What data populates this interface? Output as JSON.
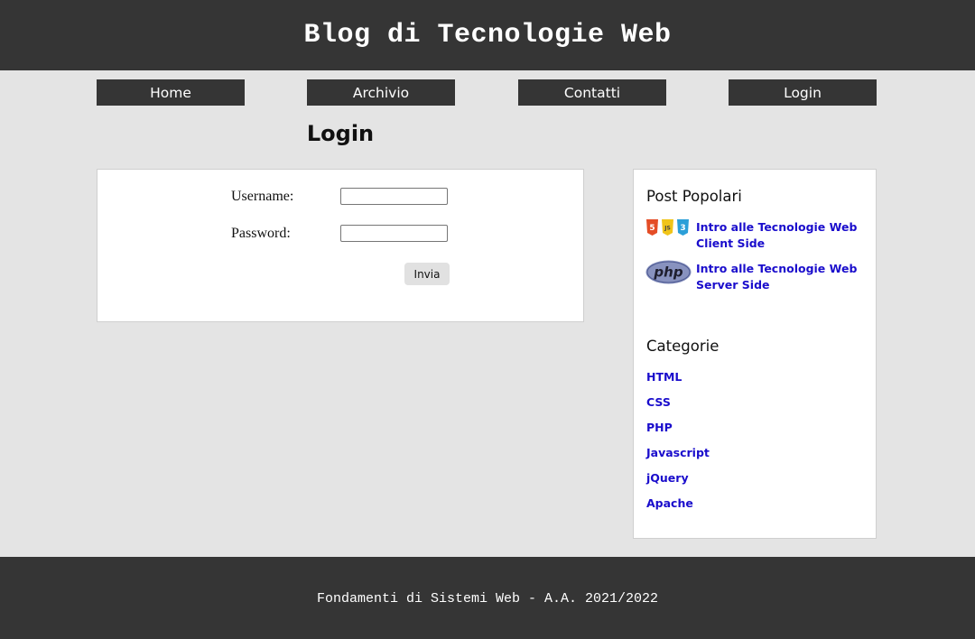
{
  "header": {
    "title": "Blog di Tecnologie Web"
  },
  "nav": {
    "items": [
      {
        "label": "Home"
      },
      {
        "label": "Archivio"
      },
      {
        "label": "Contatti"
      },
      {
        "label": "Login"
      }
    ]
  },
  "main": {
    "page_title": "Login",
    "form": {
      "username_label": "Username:",
      "username_value": "",
      "password_label": "Password:",
      "password_value": "",
      "submit_label": "Invia"
    }
  },
  "sidebar": {
    "popular_heading": "Post Popolari",
    "popular_posts": [
      {
        "title": "Intro alle Tecnologie Web Client Side",
        "icon": "html5-css3-js-icons",
        "icon_badges": [
          "5",
          "JS",
          "3"
        ]
      },
      {
        "title": "Intro alle Tecnologie Web Server Side",
        "icon": "php-logo-icon",
        "icon_text": "php"
      }
    ],
    "categories_heading": "Categorie",
    "categories": [
      "HTML",
      "CSS",
      "PHP",
      "Javascript",
      "jQuery",
      "Apache"
    ]
  },
  "footer": {
    "text": "Fondamenti di Sistemi Web - A.A. 2021/2022"
  },
  "colors": {
    "dark_bar": "#353535",
    "page_background": "#e4e4e4",
    "link": "#1a0dcc",
    "html5_orange": "#e44d26",
    "js_yellow": "#f0c419",
    "css3_blue": "#2b9fd8",
    "php_purple": "#8892bf"
  }
}
